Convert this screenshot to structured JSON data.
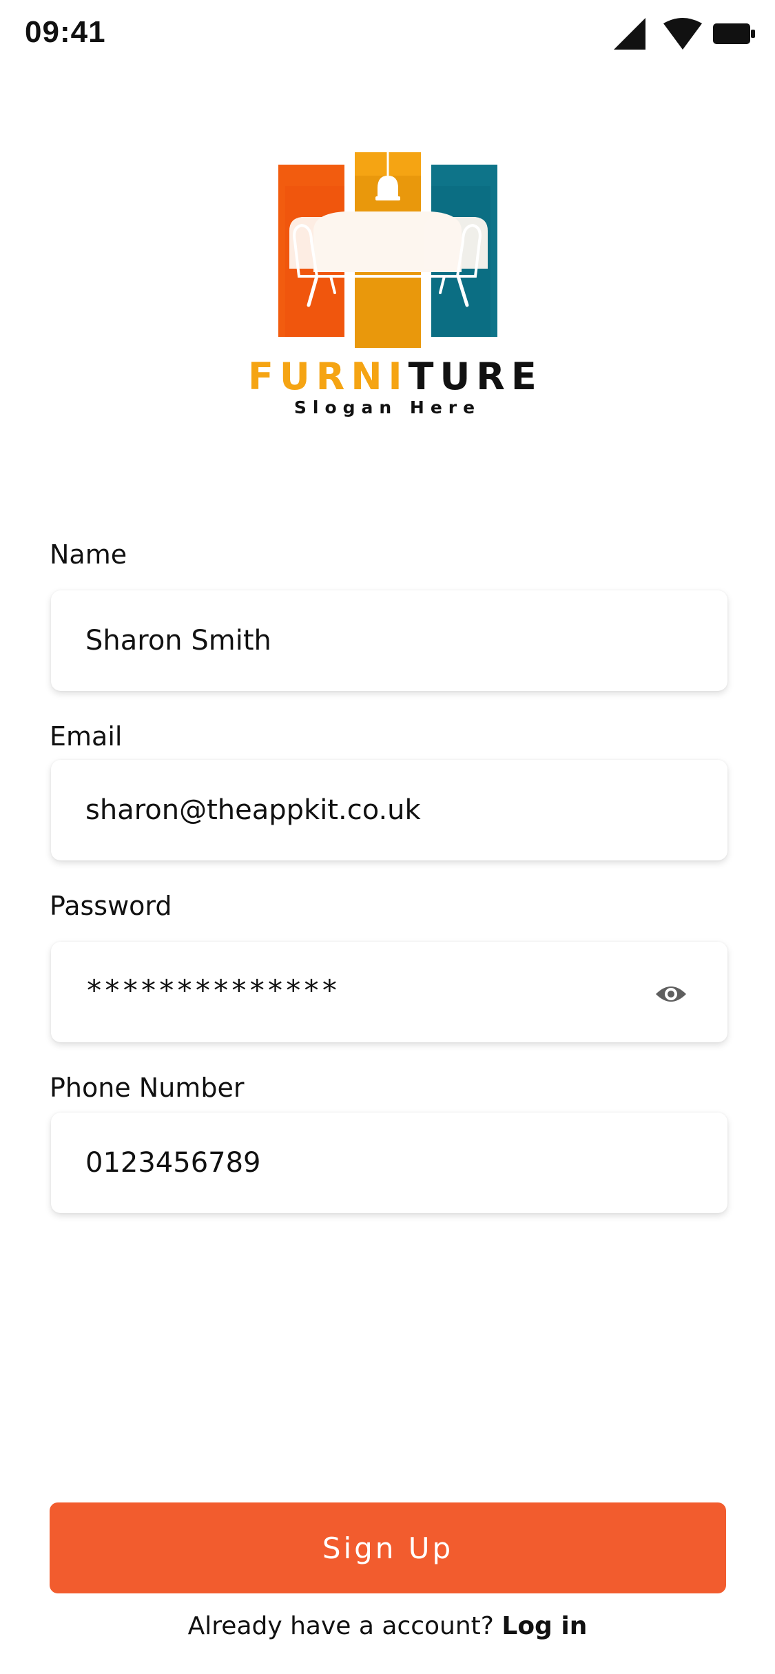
{
  "status_bar": {
    "time": "09:41",
    "icons": [
      "cellular-signal-icon",
      "wifi-icon",
      "battery-icon"
    ]
  },
  "logo": {
    "word_part1": "FURNI",
    "word_part2": "TURE",
    "slogan": "Slogan Here",
    "colors": {
      "orange": "#f25c0f",
      "amber": "#f5a413",
      "teal": "#0e7489"
    }
  },
  "form": {
    "name": {
      "label": "Name",
      "value": "Sharon Smith"
    },
    "email": {
      "label": "Email",
      "value": "sharon@theappkit.co.uk"
    },
    "password": {
      "label": "Password",
      "value": "**************",
      "toggle_icon": "eye-icon"
    },
    "phone": {
      "label": "Phone Number",
      "value": "0123456789"
    }
  },
  "signup_button": {
    "label": "Sign Up",
    "color": "#f25c2e"
  },
  "footer": {
    "prompt": "Already have a account?",
    "login_label": "Log in"
  }
}
